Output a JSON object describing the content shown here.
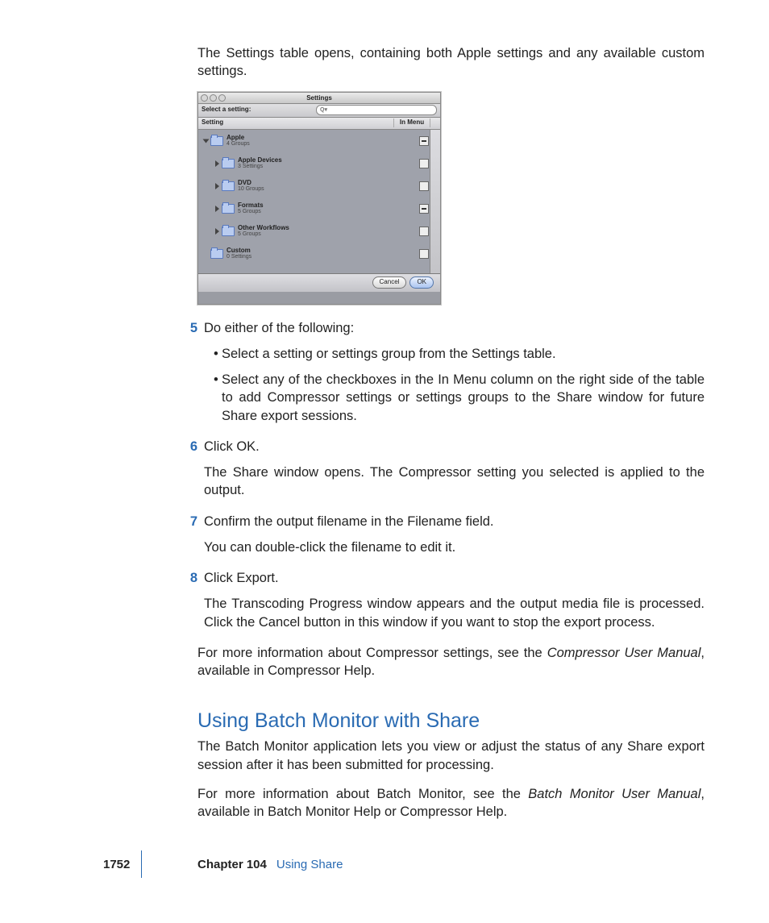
{
  "intro": "The Settings table opens, containing both Apple settings and any available custom settings.",
  "window": {
    "title": "Settings",
    "selectLabel": "Select a setting:",
    "searchPrefix": "Q▾",
    "colSetting": "Setting",
    "colInMenu": "In Menu",
    "rows": [
      {
        "indent": 0,
        "open": true,
        "name": "Apple",
        "sub": "4 Groups",
        "mixed": true
      },
      {
        "indent": 1,
        "open": false,
        "name": "Apple Devices",
        "sub": "3 Settings",
        "mixed": false
      },
      {
        "indent": 1,
        "open": false,
        "name": "DVD",
        "sub": "10 Groups",
        "mixed": false
      },
      {
        "indent": 1,
        "open": false,
        "name": "Formats",
        "sub": "5 Groups",
        "mixed": true
      },
      {
        "indent": 1,
        "open": false,
        "name": "Other Workflows",
        "sub": "5 Groups",
        "mixed": false
      },
      {
        "indent": 0,
        "open": null,
        "name": "Custom",
        "sub": "0 Settings",
        "mixed": false
      }
    ],
    "cancel": "Cancel",
    "ok": "OK"
  },
  "steps": {
    "s5": {
      "num": "5",
      "lead": "Do either of the following:",
      "bullets": [
        "Select a setting or settings group from the Settings table.",
        "Select any of the checkboxes in the In Menu column on the right side of the table to add Compressor settings or settings groups to the Share window for future Share export sessions."
      ]
    },
    "s6": {
      "num": "6",
      "lead": "Click OK.",
      "follow": "The Share window opens. The Compressor setting you selected is applied to the output."
    },
    "s7": {
      "num": "7",
      "lead": "Confirm the output filename in the Filename field.",
      "follow": "You can double-click the filename to edit it."
    },
    "s8": {
      "num": "8",
      "lead": "Click Export.",
      "follow": "The Transcoding Progress window appears and the output media file is processed. Click the Cancel button in this window if you want to stop the export process."
    }
  },
  "closing1a": "For more information about Compressor settings, see the ",
  "closing1i": "Compressor User Manual",
  "closing1b": ", available in Compressor Help.",
  "heading": "Using Batch Monitor with Share",
  "batch1": "The Batch Monitor application lets you view or adjust the status of any Share export session after it has been submitted for processing.",
  "batch2a": "For more information about Batch Monitor, see the ",
  "batch2i": "Batch Monitor User Manual",
  "batch2b": ", available in Batch Monitor Help or Compressor Help.",
  "footer": {
    "page": "1752",
    "chapter": "Chapter 104",
    "title": "Using Share"
  }
}
